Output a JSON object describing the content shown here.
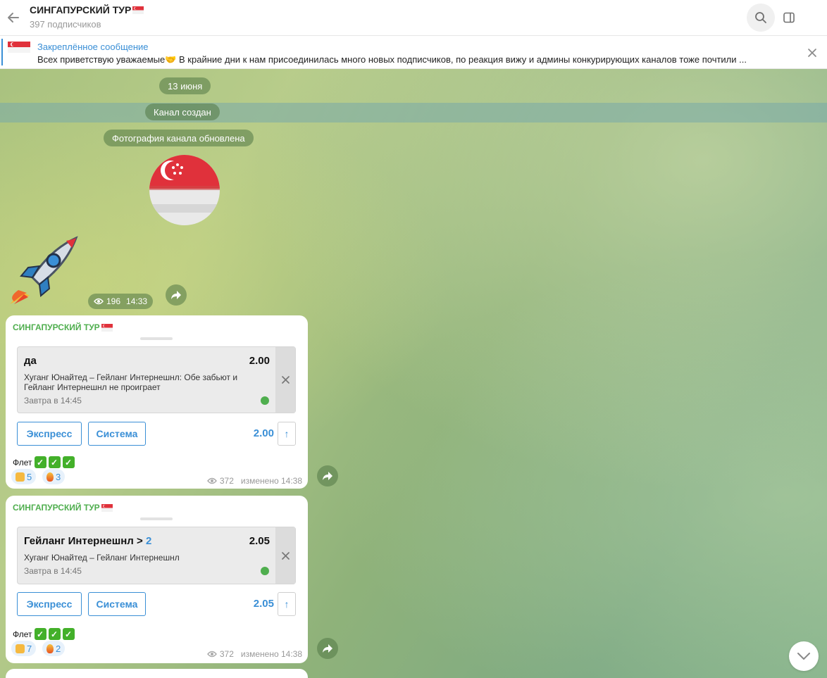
{
  "header": {
    "title": "СИНГАПУРСКИЙ ТУР",
    "subscribers": "397 подписчиков"
  },
  "pinned": {
    "label": "Закреплённое сообщение",
    "text": "Всех приветствую уважаемые🤝   В крайние дни к нам присоединилась много новых подписчиков, по реакция вижу и админы конкурирующих каналов тоже почтили ..."
  },
  "service": {
    "date": "13 июня",
    "created": "Канал создан",
    "photo_updated": "Фотография канала обновлена"
  },
  "sticker_post": {
    "views": "196",
    "time": "14:33"
  },
  "messages": [
    {
      "author": "СИНГАПУРСКИЙ ТУР",
      "pick": "да",
      "pick_num": "",
      "odd": "2.00",
      "match": "Хуганг Юнайтед – Гейланг Интернешнл: Обе забьют и Гейланг Интернешнл не проиграет",
      "when": "Завтра в 14:45",
      "btn_express": "Экспресс",
      "btn_system": "Система",
      "total": "2.00",
      "caption": "Флет",
      "react_thumbs": "5",
      "react_fire": "3",
      "views": "372",
      "edited": "изменено 14:38"
    },
    {
      "author": "СИНГАПУРСКИЙ ТУР",
      "pick": "Гейланг Интернешнл >",
      "pick_num": "2",
      "odd": "2.05",
      "match": "Хуганг Юнайтед – Гейланг Интернешнл",
      "when": "Завтра в 14:45",
      "btn_express": "Экспресс",
      "btn_system": "Система",
      "total": "2.05",
      "caption": "Флет",
      "react_thumbs": "7",
      "react_fire": "2",
      "views": "372",
      "edited": "изменено 14:38"
    }
  ],
  "colors": {
    "accent": "#3a8fd6",
    "author": "#4fae4e",
    "check": "#43b02a"
  },
  "icons": [
    "back-arrow-icon",
    "search-icon",
    "sidebar-toggle-icon",
    "close-icon",
    "forward-icon",
    "eye-icon",
    "chevron-down-icon",
    "singapore-flag-icon",
    "rocket-sticker",
    "soccer-ball-icon"
  ]
}
